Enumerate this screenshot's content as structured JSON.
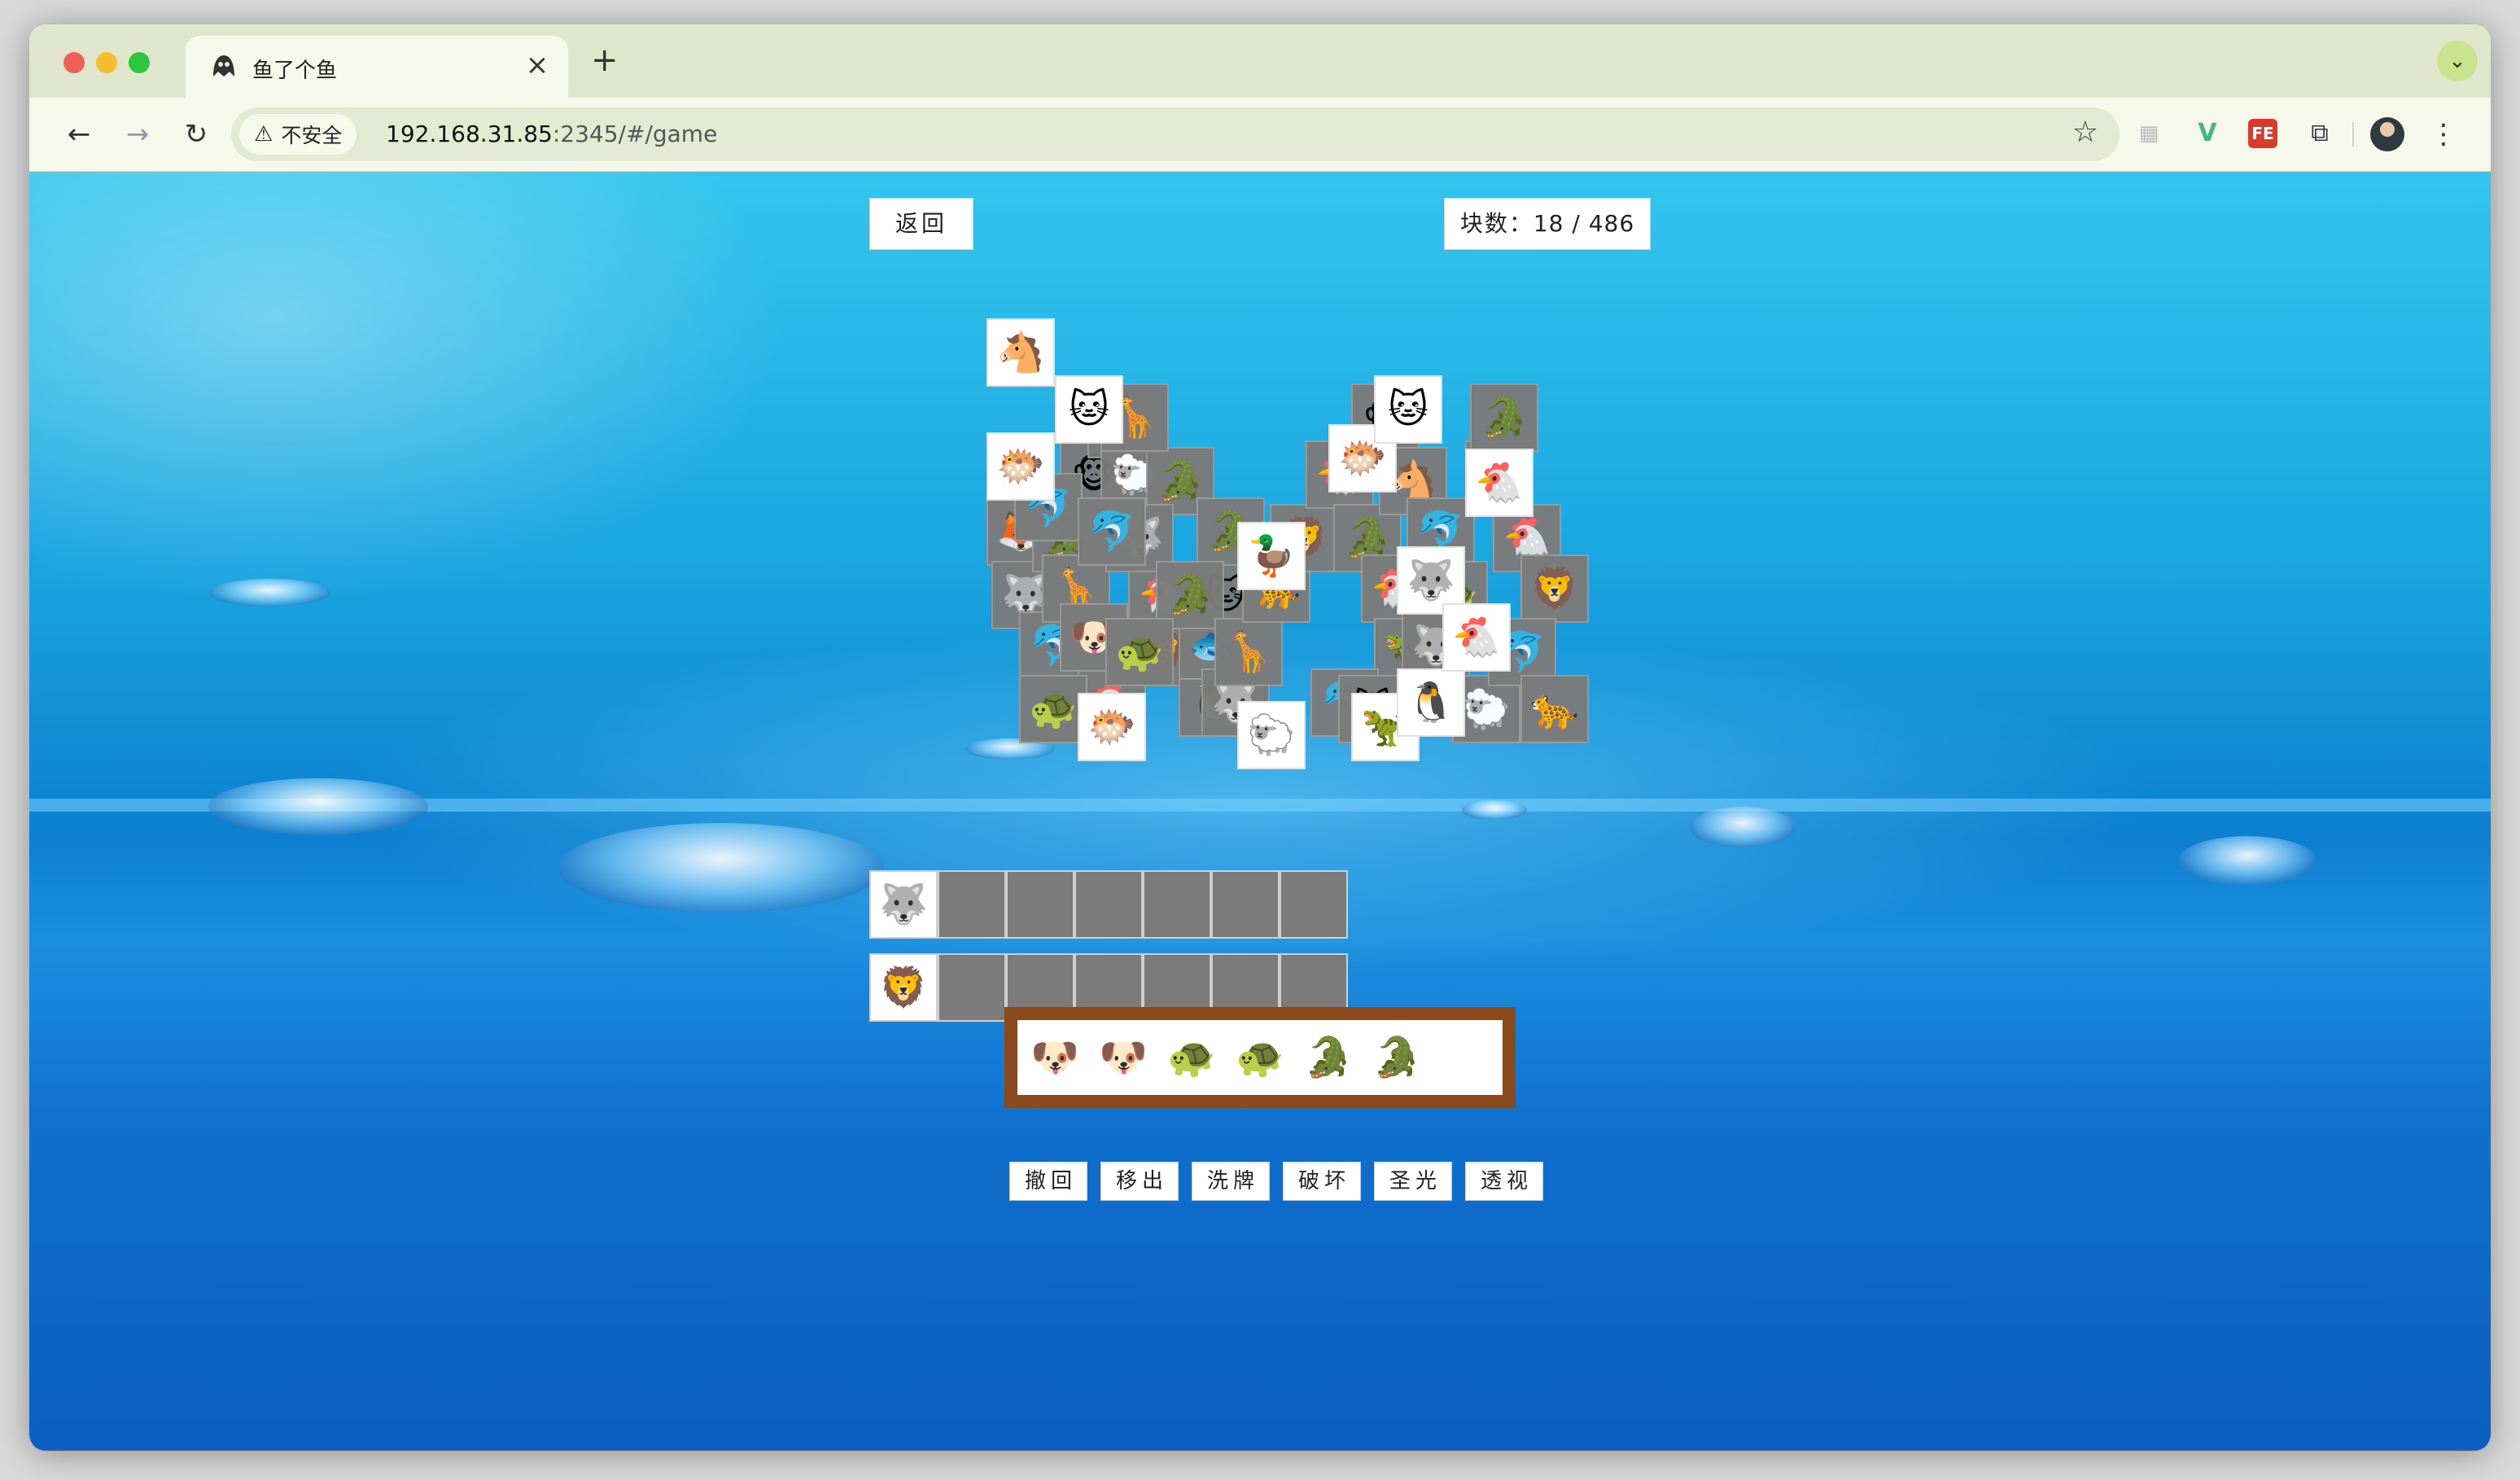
{
  "browser": {
    "tab": {
      "title": "鱼了个鱼",
      "favicon": "ghost-icon",
      "close": "×"
    },
    "new_tab": "+",
    "tab_menu": "⌄",
    "nav": {
      "back": "←",
      "forward": "→",
      "reload": "↻"
    },
    "security_label": "不安全",
    "url_host": "192.168.31.85",
    "url_rest": ":2345/#/game",
    "bookmark_icon": "☆",
    "extensions": [
      {
        "name": "extension-icon",
        "glyph": "▦"
      },
      {
        "name": "vue-devtools-icon",
        "glyph": "V"
      },
      {
        "name": "fe-helper-icon",
        "glyph": "FE"
      },
      {
        "name": "puzzle-icon",
        "glyph": "⧉"
      }
    ],
    "menu": "⋮"
  },
  "game": {
    "back_label": "返回",
    "counter_label": "块数：",
    "counter_value": "18 / 486",
    "board": {
      "covered": [
        {
          "e": "🦊"
        },
        {
          "e": "🐺"
        },
        {
          "e": "🐬"
        },
        {
          "e": "🐊"
        },
        {
          "e": "🐵"
        },
        {
          "e": "🦆"
        },
        {
          "e": "🐑"
        },
        {
          "e": "🐔"
        },
        {
          "e": "🦒"
        },
        {
          "e": "🐳"
        },
        {
          "e": "🐬"
        },
        {
          "e": "🐢"
        },
        {
          "e": "🐔"
        },
        {
          "e": "🦁"
        },
        {
          "e": "🐧"
        },
        {
          "e": "🐊"
        },
        {
          "e": "🐶"
        },
        {
          "e": "🐢"
        },
        {
          "e": "🦒"
        },
        {
          "e": "🐺"
        },
        {
          "e": "🐟"
        },
        {
          "e": "🐱"
        },
        {
          "e": "🐊"
        },
        {
          "e": "🐊"
        },
        {
          "e": "🐬"
        },
        {
          "e": "🐢"
        },
        {
          "e": "🐺"
        },
        {
          "e": "🦒"
        },
        {
          "e": "🐆"
        },
        {
          "e": "🦁"
        },
        {
          "e": "🐔"
        },
        {
          "e": "🐊"
        },
        {
          "e": "🐔"
        },
        {
          "e": "🦖"
        },
        {
          "e": "🐬"
        },
        {
          "e": "🐱"
        },
        {
          "e": "🐵"
        },
        {
          "e": "🐴"
        },
        {
          "e": "🐬"
        },
        {
          "e": "🐢"
        },
        {
          "e": "🐺"
        },
        {
          "e": "🐑"
        },
        {
          "e": "🐊"
        },
        {
          "e": "🐔"
        },
        {
          "e": "🦁"
        },
        {
          "e": "🐬"
        },
        {
          "e": "🐊"
        },
        {
          "e": "🐆"
        }
      ],
      "free": [
        {
          "e": "🐴"
        },
        {
          "e": "🐱"
        },
        {
          "e": "🐡"
        },
        {
          "e": "🦆"
        },
        {
          "e": "🐺"
        },
        {
          "e": "🐡"
        },
        {
          "e": "🐔"
        },
        {
          "e": "🦖"
        },
        {
          "e": "🐑"
        },
        {
          "e": "🐧"
        },
        {
          "e": "🐡"
        },
        {
          "e": "🐱"
        },
        {
          "e": "🐔"
        }
      ]
    },
    "side_rows": [
      {
        "first": "🐺",
        "empty_count": 6
      },
      {
        "first": "🦁",
        "empty_count": 6
      }
    ],
    "tray": [
      "🐶",
      "🐶",
      "🐢",
      "🐢",
      "🐊",
      "🐊",
      ""
    ],
    "tools": [
      "撤回",
      "移出",
      "洗牌",
      "破坏",
      "圣光",
      "透视"
    ]
  }
}
